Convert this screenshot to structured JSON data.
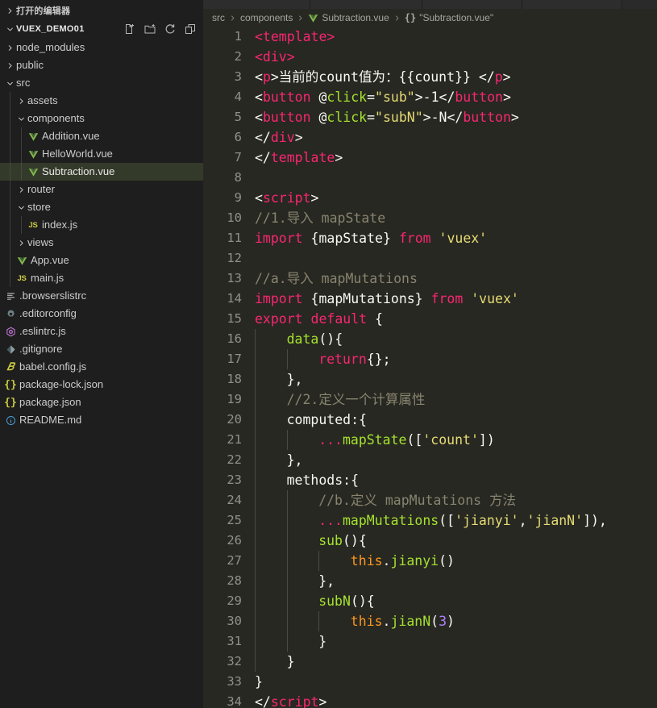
{
  "sidebar": {
    "open_editors_label": "打开的编辑器",
    "project_label": "VUEX_DEMO01",
    "actions": [
      {
        "name": "new-file-icon",
        "title": "新建文件"
      },
      {
        "name": "new-folder-icon",
        "title": "新建文件夹"
      },
      {
        "name": "refresh-icon",
        "title": "刷新"
      },
      {
        "name": "collapse-all-icon",
        "title": "全部折叠"
      }
    ],
    "tree": [
      {
        "label": "node_modules",
        "type": "folder",
        "expanded": false,
        "depth": 1,
        "icon": "chevron-right-icon"
      },
      {
        "label": "public",
        "type": "folder",
        "expanded": false,
        "depth": 1,
        "icon": "chevron-right-icon"
      },
      {
        "label": "src",
        "type": "folder",
        "expanded": true,
        "depth": 1,
        "icon": "chevron-down-icon"
      },
      {
        "label": "assets",
        "type": "folder",
        "expanded": false,
        "depth": 2,
        "icon": "chevron-right-icon"
      },
      {
        "label": "components",
        "type": "folder",
        "expanded": true,
        "depth": 2,
        "icon": "chevron-down-icon"
      },
      {
        "label": "Addition.vue",
        "type": "file",
        "depth": 3,
        "icon": "vue-icon"
      },
      {
        "label": "HelloWorld.vue",
        "type": "file",
        "depth": 3,
        "icon": "vue-icon"
      },
      {
        "label": "Subtraction.vue",
        "type": "file",
        "depth": 3,
        "icon": "vue-icon",
        "selected": true
      },
      {
        "label": "router",
        "type": "folder",
        "expanded": false,
        "depth": 2,
        "icon": "chevron-right-icon"
      },
      {
        "label": "store",
        "type": "folder",
        "expanded": true,
        "depth": 2,
        "icon": "chevron-down-icon"
      },
      {
        "label": "index.js",
        "type": "file",
        "depth": 3,
        "icon": "js-icon"
      },
      {
        "label": "views",
        "type": "folder",
        "expanded": false,
        "depth": 2,
        "icon": "chevron-right-icon"
      },
      {
        "label": "App.vue",
        "type": "file",
        "depth": 2,
        "icon": "vue-icon"
      },
      {
        "label": "main.js",
        "type": "file",
        "depth": 2,
        "icon": "js-icon"
      },
      {
        "label": ".browserslistrc",
        "type": "file",
        "depth": 1,
        "icon": "lines-icon"
      },
      {
        "label": ".editorconfig",
        "type": "file",
        "depth": 1,
        "icon": "gear-icon"
      },
      {
        "label": ".eslintrc.js",
        "type": "file",
        "depth": 1,
        "icon": "eslint-icon"
      },
      {
        "label": ".gitignore",
        "type": "file",
        "depth": 1,
        "icon": "git-icon"
      },
      {
        "label": "babel.config.js",
        "type": "file",
        "depth": 1,
        "icon": "babel-icon"
      },
      {
        "label": "package-lock.json",
        "type": "file",
        "depth": 1,
        "icon": "json-icon"
      },
      {
        "label": "package.json",
        "type": "file",
        "depth": 1,
        "icon": "json-icon"
      },
      {
        "label": "README.md",
        "type": "file",
        "depth": 1,
        "icon": "info-icon"
      }
    ]
  },
  "breadcrumb": [
    {
      "label": "src",
      "icon": null
    },
    {
      "label": "components",
      "icon": null
    },
    {
      "label": "Subtraction.vue",
      "icon": "vue-icon"
    },
    {
      "label": "\"Subtraction.vue\"",
      "icon": "json-braces-icon"
    }
  ],
  "editor": {
    "filename": "Subtraction.vue",
    "first_line": 1,
    "last_line": 34,
    "lines": [
      {
        "n": 1,
        "indent": 0,
        "tokens": [
          [
            "t-tag",
            "<template>"
          ]
        ]
      },
      {
        "n": 2,
        "indent": 0,
        "tokens": [
          [
            "t-tag",
            "<div>"
          ]
        ]
      },
      {
        "n": 3,
        "indent": 0,
        "tokens": [
          [
            "t-plain",
            "<"
          ],
          [
            "t-tag",
            "p"
          ],
          [
            "t-plain",
            ">当前的count值为：{{count}} </"
          ],
          [
            "t-tag",
            "p"
          ],
          [
            "t-plain",
            ">"
          ]
        ]
      },
      {
        "n": 4,
        "indent": 0,
        "tokens": [
          [
            "t-plain",
            "<"
          ],
          [
            "t-tag",
            "button"
          ],
          [
            "t-plain",
            " @"
          ],
          [
            "t-attr",
            "click"
          ],
          [
            "t-plain",
            "="
          ],
          [
            "t-str",
            "\"sub\""
          ],
          [
            "t-plain",
            ">-1</"
          ],
          [
            "t-tag",
            "button"
          ],
          [
            "t-plain",
            ">"
          ]
        ]
      },
      {
        "n": 5,
        "indent": 0,
        "tokens": [
          [
            "t-plain",
            "<"
          ],
          [
            "t-tag",
            "button"
          ],
          [
            "t-plain",
            " @"
          ],
          [
            "t-attr",
            "click"
          ],
          [
            "t-plain",
            "="
          ],
          [
            "t-str",
            "\"subN\""
          ],
          [
            "t-plain",
            ">-N</"
          ],
          [
            "t-tag",
            "button"
          ],
          [
            "t-plain",
            ">"
          ]
        ]
      },
      {
        "n": 6,
        "indent": 0,
        "tokens": [
          [
            "t-plain",
            "</"
          ],
          [
            "t-tag",
            "div"
          ],
          [
            "t-plain",
            ">"
          ]
        ]
      },
      {
        "n": 7,
        "indent": 0,
        "tokens": [
          [
            "t-plain",
            "</"
          ],
          [
            "t-tag",
            "template"
          ],
          [
            "t-plain",
            ">"
          ]
        ]
      },
      {
        "n": 8,
        "indent": 0,
        "tokens": []
      },
      {
        "n": 9,
        "indent": 0,
        "tokens": [
          [
            "t-plain",
            "<"
          ],
          [
            "t-tag",
            "script"
          ],
          [
            "t-plain",
            ">"
          ]
        ]
      },
      {
        "n": 10,
        "indent": 0,
        "tokens": [
          [
            "t-com",
            "//1.导入 mapState"
          ]
        ]
      },
      {
        "n": 11,
        "indent": 0,
        "tokens": [
          [
            "t-kw",
            "import"
          ],
          [
            "t-plain",
            " {mapState} "
          ],
          [
            "t-kw",
            "from"
          ],
          [
            "t-plain",
            " "
          ],
          [
            "t-str",
            "'vuex'"
          ]
        ]
      },
      {
        "n": 12,
        "indent": 0,
        "tokens": []
      },
      {
        "n": 13,
        "indent": 0,
        "tokens": [
          [
            "t-com",
            "//a.导入 mapMutations"
          ]
        ]
      },
      {
        "n": 14,
        "indent": 0,
        "tokens": [
          [
            "t-kw",
            "import"
          ],
          [
            "t-plain",
            " {mapMutations} "
          ],
          [
            "t-kw",
            "from"
          ],
          [
            "t-plain",
            " "
          ],
          [
            "t-str",
            "'vuex'"
          ]
        ]
      },
      {
        "n": 15,
        "indent": 0,
        "tokens": [
          [
            "t-kw",
            "export default"
          ],
          [
            "t-plain",
            " {"
          ]
        ]
      },
      {
        "n": 16,
        "indent": 1,
        "tokens": [
          [
            "t-fn",
            "data"
          ],
          [
            "t-plain",
            "(){"
          ]
        ]
      },
      {
        "n": 17,
        "indent": 2,
        "tokens": [
          [
            "t-kw",
            "return"
          ],
          [
            "t-plain",
            "{};"
          ]
        ]
      },
      {
        "n": 18,
        "indent": 1,
        "tokens": [
          [
            "t-plain",
            "},"
          ]
        ]
      },
      {
        "n": 19,
        "indent": 1,
        "tokens": [
          [
            "t-com",
            "//2.定义一个计算属性"
          ]
        ]
      },
      {
        "n": 20,
        "indent": 1,
        "tokens": [
          [
            "t-plain",
            "computed:{"
          ]
        ]
      },
      {
        "n": 21,
        "indent": 2,
        "tokens": [
          [
            "t-kw",
            "..."
          ],
          [
            "t-fn",
            "mapState"
          ],
          [
            "t-plain",
            "(["
          ],
          [
            "t-str",
            "'count'"
          ],
          [
            "t-plain",
            "])"
          ]
        ]
      },
      {
        "n": 22,
        "indent": 1,
        "tokens": [
          [
            "t-plain",
            "},"
          ]
        ]
      },
      {
        "n": 23,
        "indent": 1,
        "tokens": [
          [
            "t-plain",
            "methods:{"
          ]
        ]
      },
      {
        "n": 24,
        "indent": 2,
        "tokens": [
          [
            "t-com",
            "//b.定义 mapMutations 方法"
          ]
        ]
      },
      {
        "n": 25,
        "indent": 2,
        "tokens": [
          [
            "t-kw",
            "..."
          ],
          [
            "t-fn",
            "mapMutations"
          ],
          [
            "t-plain",
            "(["
          ],
          [
            "t-str",
            "'jianyi'"
          ],
          [
            "t-plain",
            ","
          ],
          [
            "t-str",
            "'jianN'"
          ],
          [
            "t-plain",
            "]),"
          ]
        ]
      },
      {
        "n": 26,
        "indent": 2,
        "tokens": [
          [
            "t-fn",
            "sub"
          ],
          [
            "t-plain",
            "(){"
          ]
        ]
      },
      {
        "n": 27,
        "indent": 3,
        "tokens": [
          [
            "t-this",
            "this"
          ],
          [
            "t-plain",
            "."
          ],
          [
            "t-fn",
            "jianyi"
          ],
          [
            "t-plain",
            "()"
          ]
        ]
      },
      {
        "n": 28,
        "indent": 2,
        "tokens": [
          [
            "t-plain",
            "},"
          ]
        ]
      },
      {
        "n": 29,
        "indent": 2,
        "tokens": [
          [
            "t-fn",
            "subN"
          ],
          [
            "t-plain",
            "(){"
          ]
        ]
      },
      {
        "n": 30,
        "indent": 3,
        "tokens": [
          [
            "t-this",
            "this"
          ],
          [
            "t-plain",
            "."
          ],
          [
            "t-fn",
            "jianN"
          ],
          [
            "t-plain",
            "("
          ],
          [
            "t-num",
            "3"
          ],
          [
            "t-plain",
            ")"
          ]
        ]
      },
      {
        "n": 31,
        "indent": 2,
        "tokens": [
          [
            "t-plain",
            "}"
          ]
        ]
      },
      {
        "n": 32,
        "indent": 1,
        "tokens": [
          [
            "t-plain",
            "}"
          ]
        ]
      },
      {
        "n": 33,
        "indent": 0,
        "tokens": [
          [
            "t-plain",
            "}"
          ]
        ]
      },
      {
        "n": 34,
        "indent": 0,
        "tokens": [
          [
            "t-plain",
            "</"
          ],
          [
            "t-tag",
            "script"
          ],
          [
            "t-plain",
            ">"
          ]
        ]
      }
    ]
  },
  "colors": {
    "sidebar_bg": "#1e1e1e",
    "editor_bg": "#272822",
    "tag": "#f92672",
    "string": "#e6db74",
    "function": "#a6e22e",
    "comment": "#88846f",
    "number": "#ae81ff",
    "this_kw": "#fd971f",
    "foreground": "#f8f8f2",
    "line_number": "#8f908a",
    "vue_green": "#81b64c"
  }
}
